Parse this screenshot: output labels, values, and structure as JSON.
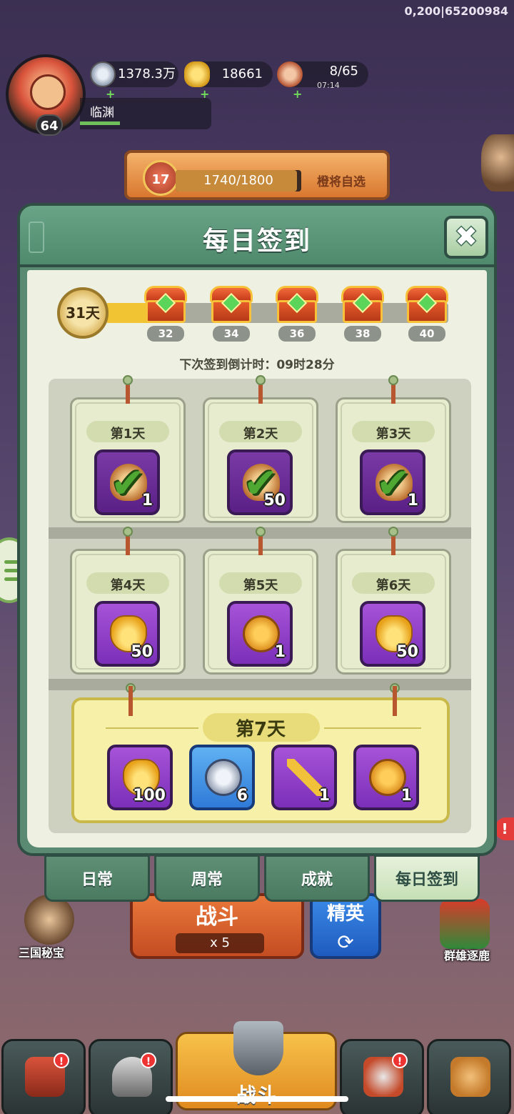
{
  "hud": {
    "debug_id": "0,200|65200984",
    "player_level": "64",
    "player_name": "临渊",
    "silver": "1378.3万",
    "gold": "18661",
    "stamina": "8/65",
    "stamina_timer": "07:14"
  },
  "battle_pass": {
    "level": "17",
    "progress_text": "1740/1800",
    "progress_fraction": 0.967,
    "select_label": "橙将自选"
  },
  "dialog": {
    "title": "每日签到",
    "close_label": "✖",
    "signed_days_label": "31天",
    "milestones": [
      "32",
      "34",
      "36",
      "38",
      "40"
    ],
    "progress_fraction": 0.0,
    "countdown": "下次签到倒计时：09时28分",
    "days": [
      {
        "label": "第1天",
        "qty": "1",
        "claimed": true,
        "icon": "food-ration-icon"
      },
      {
        "label": "第2天",
        "qty": "50",
        "claimed": true,
        "icon": "food-ration-icon"
      },
      {
        "label": "第3天",
        "qty": "1",
        "claimed": true,
        "icon": "food-ration-icon"
      },
      {
        "label": "第4天",
        "qty": "50",
        "claimed": false,
        "icon": "gold-ingot-icon"
      },
      {
        "label": "第5天",
        "qty": "1",
        "claimed": false,
        "icon": "gold-coin-icon"
      },
      {
        "label": "第6天",
        "qty": "50",
        "claimed": false,
        "icon": "gold-ingot-icon"
      }
    ],
    "day7": {
      "label": "第7天",
      "items": [
        {
          "qty": "100",
          "icon": "gold-ingot-icon"
        },
        {
          "qty": "6",
          "icon": "silver-coin-icon"
        },
        {
          "qty": "1",
          "icon": "key-icon"
        },
        {
          "qty": "1",
          "icon": "gold-coin-icon"
        }
      ]
    }
  },
  "tabs": [
    "日常",
    "周常",
    "成就",
    "每日签到"
  ],
  "active_tab": "每日签到",
  "lower": {
    "battle_label": "战斗",
    "battle_cost": "x 5",
    "elite_label": "精英",
    "feature_left": "三国秘宝",
    "feature_right": "群雄逐鹿",
    "nav_center_label": "战斗"
  },
  "colors": {
    "dialog_frame": "#5b8a72",
    "active_tab": "#c5dfb5",
    "progress_fill": "#f0c432",
    "item_tile_purple": "#a653d8",
    "item_tile_blue": "#2f7ad8"
  }
}
